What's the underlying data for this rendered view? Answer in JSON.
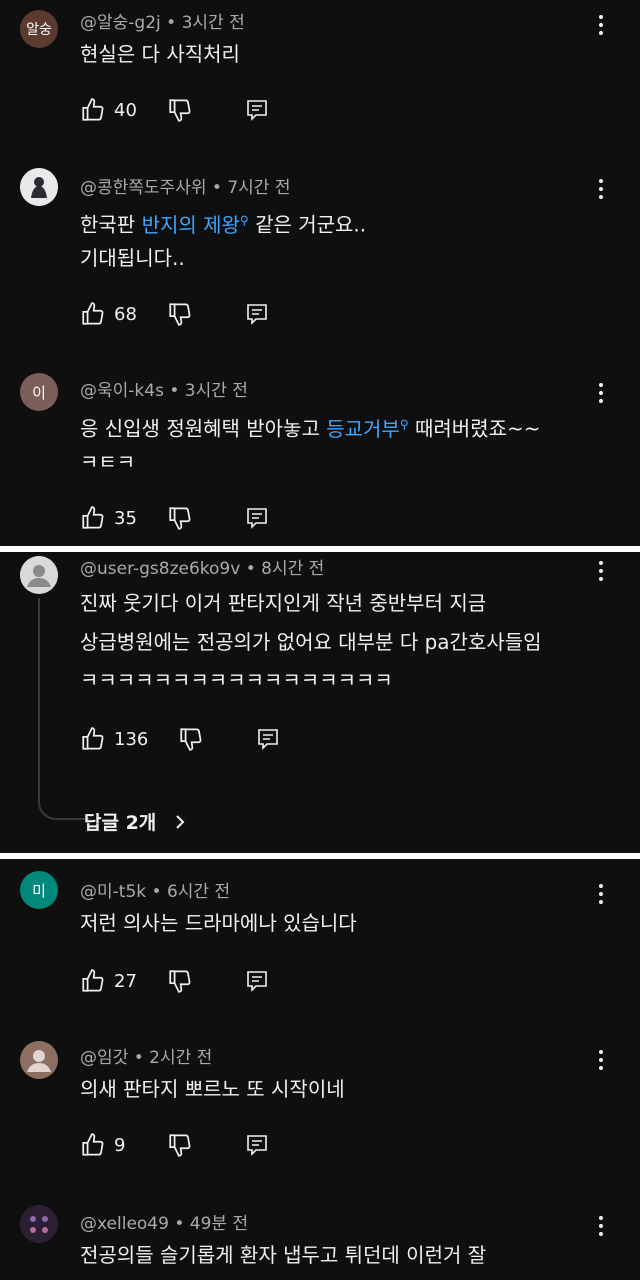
{
  "comments": [
    {
      "avatar_text": "알숭",
      "avatar_color": "#5b3a30",
      "author": "@알숭-g2j",
      "time": "3시간 전",
      "line1": "현실은 다 사직처리",
      "likes": "40"
    },
    {
      "avatar_text": "",
      "avatar_color": "#e9e9ec",
      "author": "@콩한쪽도주사위",
      "time": "7시간 전",
      "line1_a": "한국판 ",
      "line1_link": "반지의 제왕",
      "line1_b": " 같은 거군요..",
      "line2": "기대됩니다..",
      "likes": "68"
    },
    {
      "avatar_text": "이",
      "avatar_color": "#7b5e57",
      "author": "@욱이-k4s",
      "time": "3시간 전",
      "line1_a": "응 신입생 정원혜택 받아놓고 ",
      "line1_link": "등교거부",
      "line1_b": " 때려버렸죠~~",
      "line2": "ㅋㅌㅋ",
      "likes": "35"
    },
    {
      "avatar_text": "",
      "avatar_color": "#d9d9d9",
      "author": "@user-gs8ze6ko9v",
      "time": "8시간 전",
      "line1": "진짜 웃기다 이거 판타지인게 작년 중반부터 지금",
      "line2": "상급병원에는 전공의가 없어요 대부분 다 pa간호사들임",
      "line3": "ㅋㅋㅋㅋㅋㅋㅋㅋㅋㅋㅋㅋㅋㅋㅋㅋㅋ",
      "likes": "136",
      "replies": "답글 2개"
    },
    {
      "avatar_text": "미",
      "avatar_color": "#00897b",
      "author": "@미-t5k",
      "time": "6시간 전",
      "line1": "저런 의사는 드라마에나 있습니다",
      "likes": "27"
    },
    {
      "avatar_text": "",
      "avatar_color": "#8d6e63",
      "author": "@임갓",
      "time": "2시간 전",
      "line1": "의새 판타지 뽀르노 또 시작이네",
      "likes": "9"
    },
    {
      "avatar_text": "",
      "avatar_color": "#2a1f33",
      "author": "@xelleo49",
      "time": "49분 전",
      "line1": "전공의들 슬기롭게 환자 냅두고 튀던데 이런거 잘"
    }
  ],
  "dot": "•",
  "search_mark": "⚲",
  "icons": [
    "thumbs-up-icon",
    "thumbs-down-icon",
    "reply-icon",
    "more-vert-icon",
    "chevron-right-icon"
  ]
}
